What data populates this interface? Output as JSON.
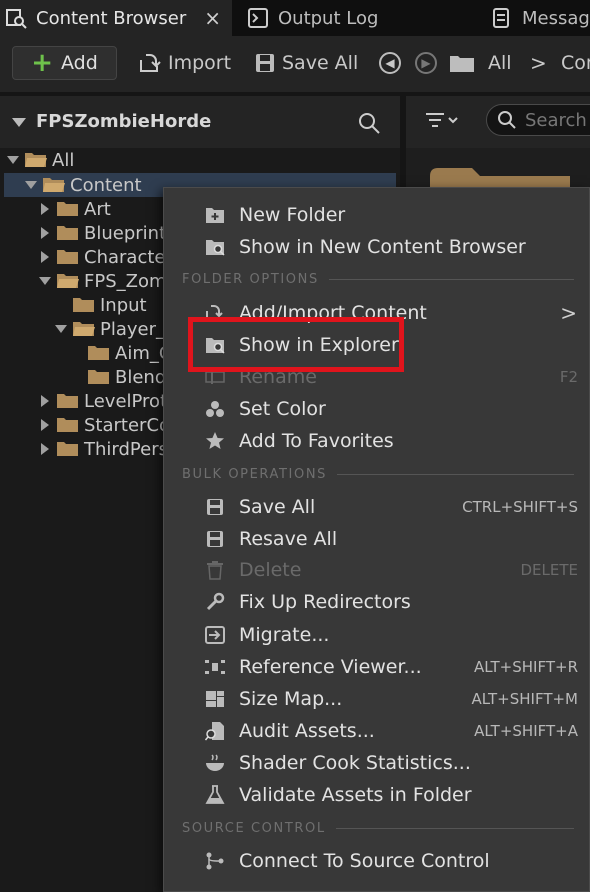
{
  "tabs": [
    {
      "label": "Content Browser",
      "icon": "content-browser-icon",
      "active": true,
      "close": "×"
    },
    {
      "label": "Output Log",
      "icon": "terminal-icon",
      "active": false
    },
    {
      "label": "Messag",
      "icon": "message-icon",
      "active": false
    }
  ],
  "toolbar": {
    "add_label": "Add",
    "import_label": "Import",
    "save_all_label": "Save All",
    "path_root": "All",
    "path_next": "Con",
    "path_separator": ">"
  },
  "tree": {
    "title": "FPSZombieHorde",
    "items": [
      {
        "label": "All",
        "expanded": true
      },
      {
        "label": "Content",
        "expanded": true,
        "selected": true
      },
      {
        "label": "Art"
      },
      {
        "label": "Blueprint"
      },
      {
        "label": "Characte"
      },
      {
        "label": "FPS_Zom",
        "expanded": true
      },
      {
        "label": "Input"
      },
      {
        "label": "Player_",
        "expanded": true
      },
      {
        "label": "Aim_C"
      },
      {
        "label": "Blend"
      },
      {
        "label": "LevelProt"
      },
      {
        "label": "StarterCo"
      },
      {
        "label": "ThirdPers"
      }
    ]
  },
  "content_search_placeholder": "Search",
  "context_menu": {
    "items_top": [
      {
        "label": "New Folder",
        "icon": "new-folder-icon"
      },
      {
        "label": "Show in New Content Browser",
        "icon": "folder-search-icon"
      }
    ],
    "folder_options_title": "FOLDER OPTIONS",
    "folder_options": [
      {
        "label": "Add/Import Content",
        "icon": "import-icon",
        "submenu": ">"
      },
      {
        "label": "Show in Explorer",
        "icon": "folder-search-icon"
      },
      {
        "label": "Rename",
        "icon": "rename-icon",
        "shortcut": "F2",
        "disabled": true
      },
      {
        "label": "Set Color",
        "icon": "color-icon"
      },
      {
        "label": "Add To Favorites",
        "icon": "star-icon"
      }
    ],
    "bulk_title": "BULK OPERATIONS",
    "bulk": [
      {
        "label": "Save All",
        "icon": "save-icon",
        "shortcut": "CTRL+SHIFT+S"
      },
      {
        "label": "Resave All",
        "icon": "save-icon"
      },
      {
        "label": "Delete",
        "icon": "trash-icon",
        "shortcut": "DELETE",
        "disabled": true
      },
      {
        "label": "Fix Up Redirectors",
        "icon": "wrench-icon"
      },
      {
        "label": "Migrate...",
        "icon": "migrate-icon"
      },
      {
        "label": "Reference Viewer...",
        "icon": "reference-icon",
        "shortcut": "ALT+SHIFT+R"
      },
      {
        "label": "Size Map...",
        "icon": "size-map-icon",
        "shortcut": "ALT+SHIFT+M"
      },
      {
        "label": "Audit Assets...",
        "icon": "audit-icon",
        "shortcut": "ALT+SHIFT+A"
      },
      {
        "label": "Shader Cook Statistics...",
        "icon": "bowl-icon"
      },
      {
        "label": "Validate Assets in Folder",
        "icon": "flask-icon"
      }
    ],
    "source_title": "SOURCE CONTROL",
    "source": [
      {
        "label": "Connect To Source Control",
        "icon": "source-control-icon"
      }
    ]
  },
  "colors": {
    "highlight": "#e0141c",
    "folder": "#b08d5b",
    "selection": "#2f3d50",
    "add_plus": "#6ec14b"
  }
}
